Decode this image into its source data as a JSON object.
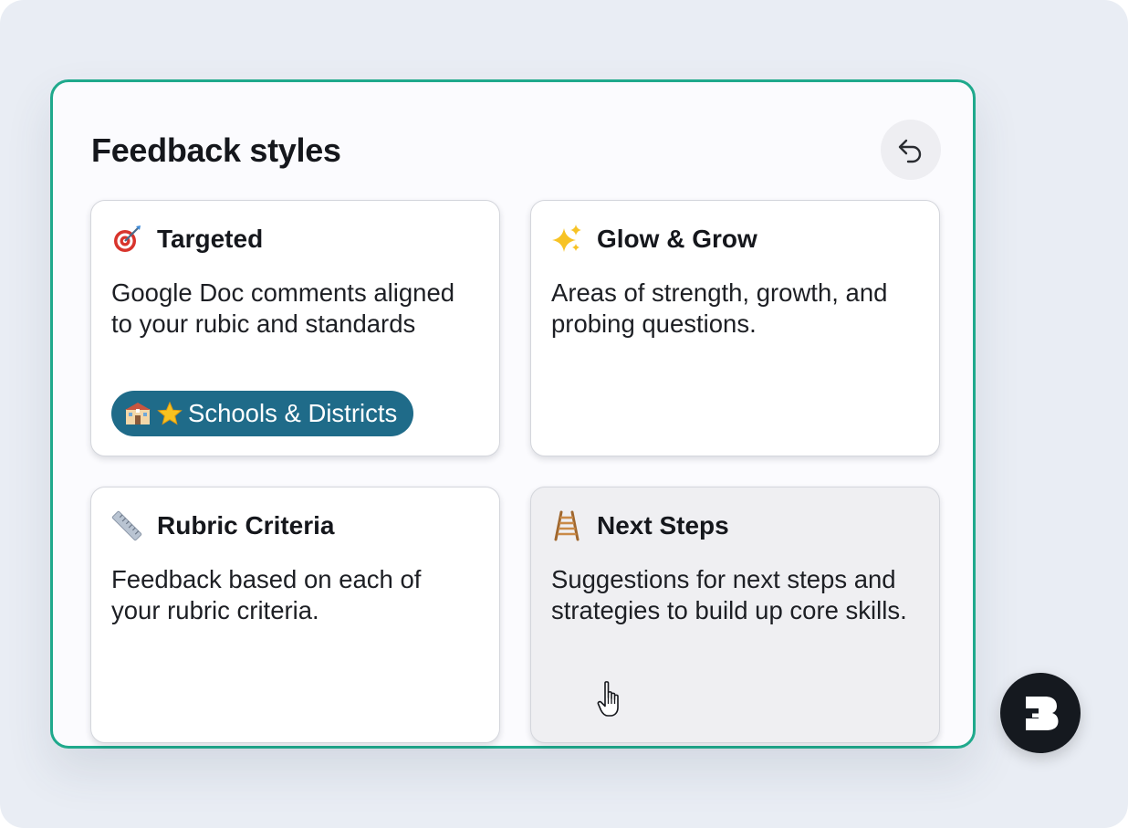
{
  "panel": {
    "title": "Feedback styles",
    "back_icon": "undo-arrow-icon"
  },
  "cards": [
    {
      "icon": "target-dart-icon",
      "title": "Targeted",
      "description": "Google Doc comments aligned to your rubic and standards",
      "badge": {
        "icons": [
          "school-icon",
          "star-icon"
        ],
        "label": "Schools & Districts"
      }
    },
    {
      "icon": "sparkles-icon",
      "title": "Glow & Grow",
      "description": "Areas of strength, growth, and probing questions."
    },
    {
      "icon": "ruler-icon",
      "title": "Rubric Criteria",
      "description": "Feedback based on each of your rubric criteria."
    },
    {
      "icon": "ladder-icon",
      "title": "Next Steps",
      "description": "Suggestions for next steps and strategies to build up core skills.",
      "state": "hovered"
    }
  ],
  "fab": {
    "icon": "brisk-logo-icon"
  },
  "cursor": {
    "icon": "pointer-hand-icon"
  },
  "colors": {
    "accent_border": "#1fa98c",
    "badge_bg": "#1f6b89",
    "background": "#e9edf4",
    "hover_card": "#efeff2"
  }
}
